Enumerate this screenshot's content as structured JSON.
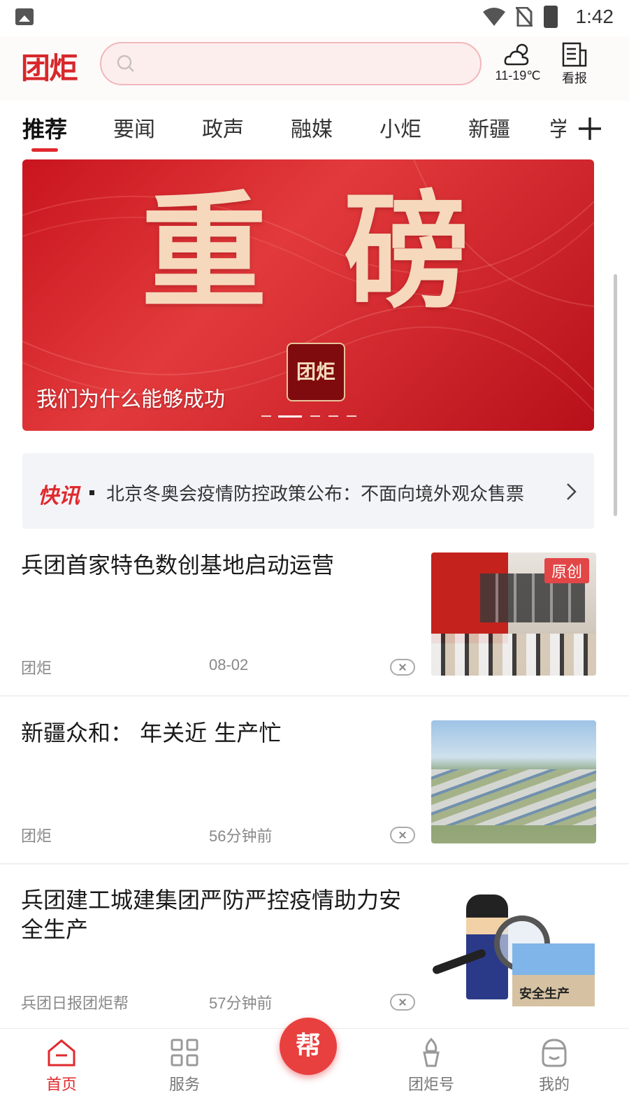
{
  "status_bar": {
    "time": "1:42"
  },
  "header": {
    "logo": "团炬",
    "search_placeholder": "",
    "weather": "11-19℃",
    "newspaper": "看报"
  },
  "tabs": {
    "items": [
      "推荐",
      "要闻",
      "政声",
      "融媒",
      "小炬",
      "新疆"
    ],
    "partial": "学",
    "active_index": 0
  },
  "banner": {
    "headline": "重磅",
    "caption": "我们为什么能够成功",
    "badge": "团炬",
    "dot_count": 5,
    "active_dot": 1
  },
  "flash": {
    "label": "快讯",
    "text": "北京冬奥会疫情防控政策公布：不面向境外观众售票"
  },
  "articles": [
    {
      "title": "兵团首家特色数创基地启动运营",
      "source": "团炬",
      "time": "08-02",
      "badge": "原创"
    },
    {
      "title": "新疆众和： 年关近 生产忙",
      "source": "团炬",
      "time": "56分钟前"
    },
    {
      "title": "兵团建工城建集团严防严控疫情助力安全生产",
      "source": "兵团日报团炬帮",
      "time": "57分钟前",
      "thumb_text": "安全生产"
    }
  ],
  "bottom_nav": {
    "items": [
      "首页",
      "服务",
      "团炬号",
      "我的"
    ],
    "center": "帮",
    "active_index": 0
  },
  "colors": {
    "accent": "#e0292d",
    "banner": "#c9151e",
    "flash_bg": "#f3f4f8"
  },
  "icons": [
    "gallery-icon",
    "wifi-icon",
    "sim-icon",
    "battery-icon",
    "search-icon",
    "weather-icon",
    "newspaper-icon",
    "plus-icon",
    "chevron-right-icon",
    "close-icon",
    "home-icon",
    "grid-icon",
    "torch-icon",
    "profile-icon"
  ]
}
